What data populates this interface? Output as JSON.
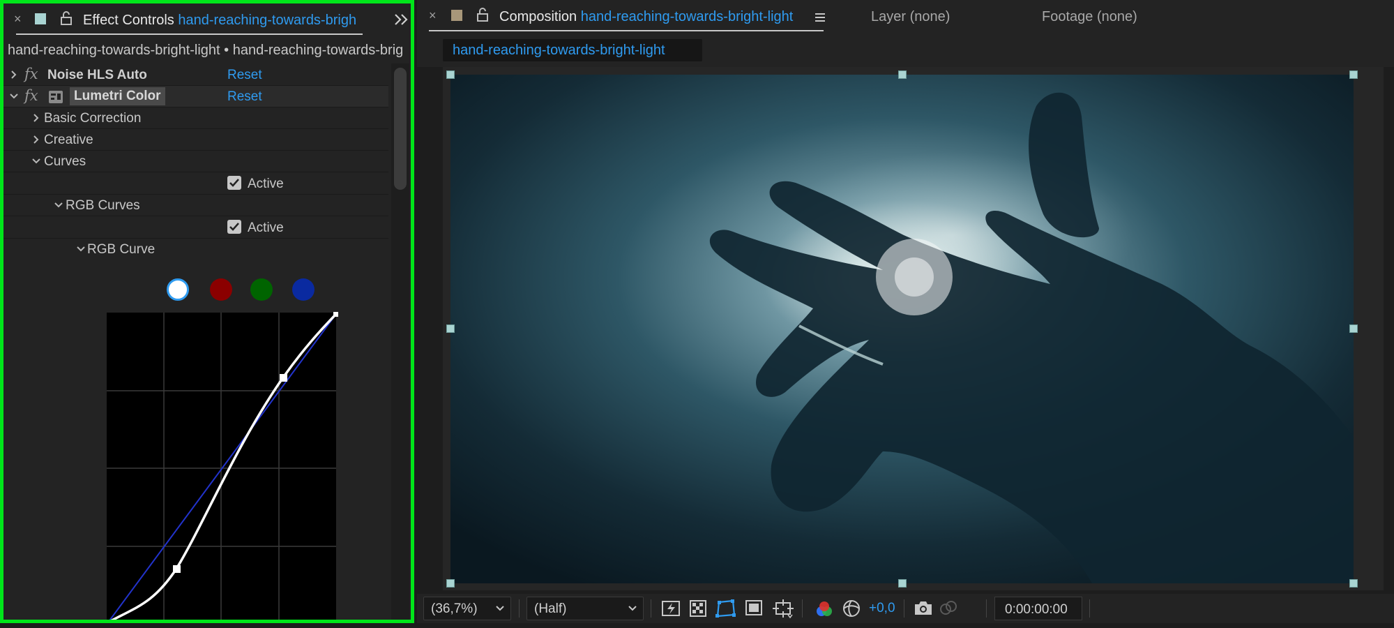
{
  "effect_panel": {
    "tab_prefix": "Effect Controls",
    "tab_target": "hand-reaching-towards-brigh",
    "breadcrumb": "hand-reaching-towards-bright-light • hand-reaching-towards-brig",
    "effects": [
      {
        "name": "Noise HLS Auto",
        "reset": "Reset"
      },
      {
        "name": "Lumetri Color",
        "reset": "Reset"
      }
    ],
    "sections": {
      "basic_correction": "Basic Correction",
      "creative": "Creative",
      "curves": "Curves",
      "rgb_curves": "RGB Curves",
      "rgb_curve": "RGB Curve"
    },
    "active_label": "Active",
    "active_label_2": "Active",
    "curve_channels": [
      "white",
      "red",
      "green",
      "blue"
    ]
  },
  "composition_panel": {
    "tab_prefix": "Composition",
    "tab_target": "hand-reaching-towards-bright-light",
    "layer_tab": "Layer (none)",
    "footage_tab": "Footage (none)",
    "sub_tab": "hand-reaching-towards-bright-light",
    "zoom": "(36,7%)",
    "resolution": "(Half)",
    "exposure": "+0,0",
    "timecode": "0:00:00:00"
  },
  "colors": {
    "accent": "#2f9bf0",
    "highlight_border": "#00e61a",
    "panel_bg": "#232323"
  }
}
